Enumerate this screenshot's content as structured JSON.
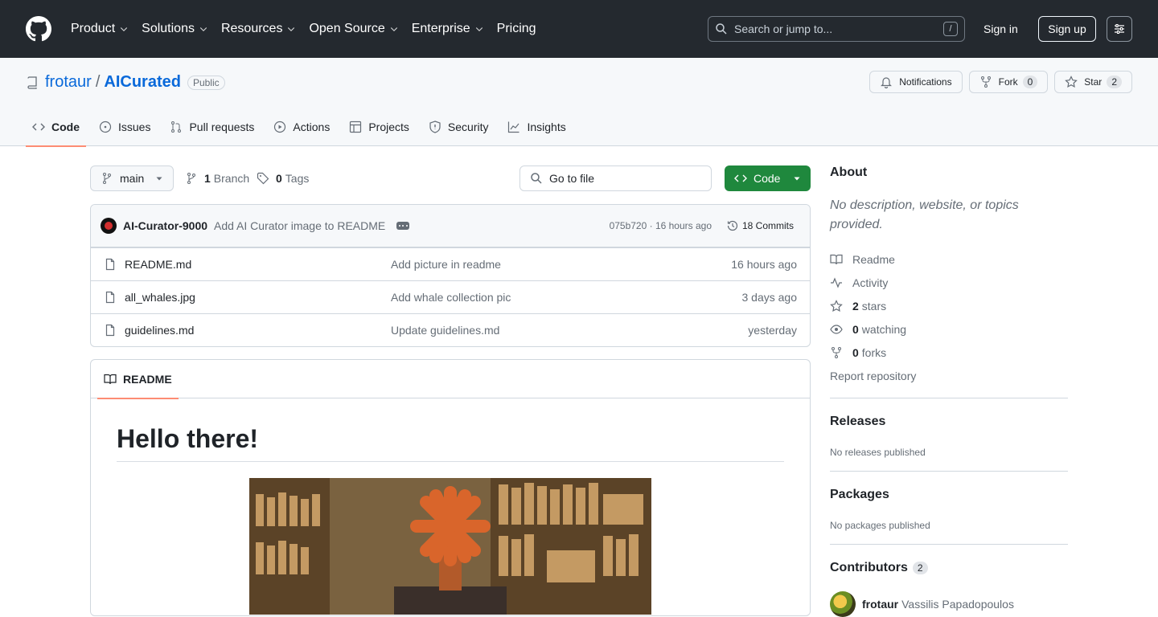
{
  "header": {
    "nav": [
      {
        "label": "Product",
        "has_menu": true
      },
      {
        "label": "Solutions",
        "has_menu": true
      },
      {
        "label": "Resources",
        "has_menu": true
      },
      {
        "label": "Open Source",
        "has_menu": true
      },
      {
        "label": "Enterprise",
        "has_menu": true
      },
      {
        "label": "Pricing",
        "has_menu": false
      }
    ],
    "search_placeholder": "Search or jump to...",
    "search_shortcut": "/",
    "sign_in": "Sign in",
    "sign_up": "Sign up"
  },
  "repo": {
    "owner": "frotaur",
    "separator": "/",
    "name": "AICurated",
    "visibility": "Public",
    "notifications_label": "Notifications",
    "fork_label": "Fork",
    "fork_count": "0",
    "star_label": "Star",
    "star_count": "2",
    "tabs": [
      {
        "label": "Code",
        "icon": "code-icon",
        "active": true
      },
      {
        "label": "Issues",
        "icon": "issue-icon",
        "active": false
      },
      {
        "label": "Pull requests",
        "icon": "pull-request-icon",
        "active": false
      },
      {
        "label": "Actions",
        "icon": "play-icon",
        "active": false
      },
      {
        "label": "Projects",
        "icon": "table-icon",
        "active": false
      },
      {
        "label": "Security",
        "icon": "shield-icon",
        "active": false
      },
      {
        "label": "Insights",
        "icon": "graph-icon",
        "active": false
      }
    ]
  },
  "toolbar": {
    "branch": "main",
    "branch_count": "1",
    "branch_label": "Branch",
    "tag_count": "0",
    "tag_label": "Tags",
    "goto_placeholder": "Go to file",
    "code_button": "Code"
  },
  "commit": {
    "author": "AI-Curator-9000",
    "message": "Add AI Curator image to README",
    "meta": "075b720 · 16 hours ago",
    "count_label": "18 Commits"
  },
  "files": [
    {
      "name": "README.md",
      "message": "Add picture in readme",
      "age": "16 hours ago"
    },
    {
      "name": "all_whales.jpg",
      "message": "Add whale collection pic",
      "age": "3 days ago"
    },
    {
      "name": "guidelines.md",
      "message": "Update guidelines.md",
      "age": "yesterday"
    }
  ],
  "readme": {
    "tab_label": "README",
    "heading": "Hello there!"
  },
  "sidebar": {
    "about_title": "About",
    "about_desc": "No description, website, or topics provided.",
    "links": {
      "readme": "Readme",
      "activity": "Activity",
      "stars_count": "2",
      "stars_label": "stars",
      "watching_count": "0",
      "watching_label": "watching",
      "forks_count": "0",
      "forks_label": "forks",
      "report": "Report repository"
    },
    "releases_title": "Releases",
    "releases_text": "No releases published",
    "packages_title": "Packages",
    "packages_text": "No packages published",
    "contributors_title": "Contributors",
    "contributors_count": "2",
    "contributor_login": "frotaur",
    "contributor_name": "Vassilis Papadopoulos"
  },
  "colors": {
    "header_bg": "#24292f",
    "accent_link": "#0969da",
    "primary_button": "#1f883d",
    "tab_underline": "#fd8c73"
  }
}
